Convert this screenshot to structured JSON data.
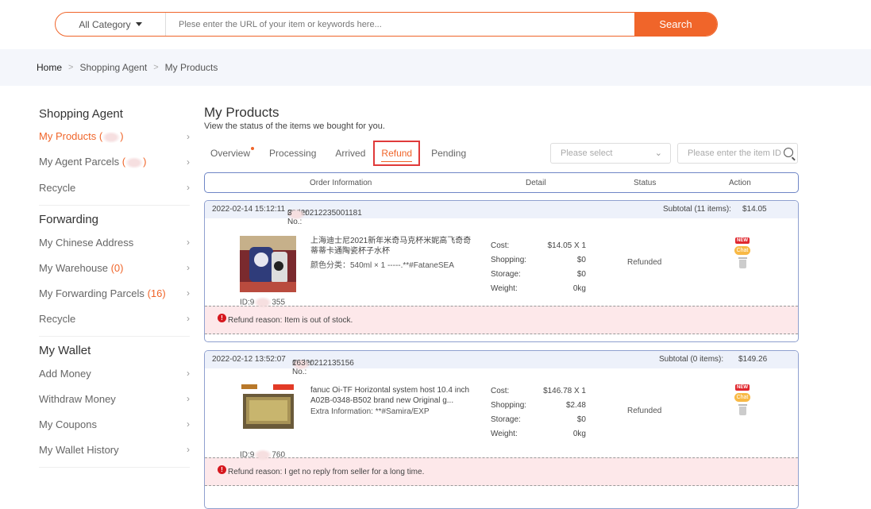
{
  "search": {
    "category": "All Category",
    "placeholder": "Plese enter the URL of your item or keywords here...",
    "button": "Search"
  },
  "breadcrumb": [
    "Home",
    "Shopping Agent",
    "My Products"
  ],
  "sidebar": {
    "groups": [
      {
        "title": "Shopping Agent",
        "items": [
          {
            "label": "My Products",
            "count": "",
            "active": true,
            "blurred": true
          },
          {
            "label": "My Agent Parcels",
            "count": "",
            "blurred": true
          },
          {
            "label": "Recycle",
            "count": ""
          }
        ]
      },
      {
        "title": "Forwarding",
        "items": [
          {
            "label": "My Chinese Address",
            "count": ""
          },
          {
            "label": "My Warehouse",
            "count": "0"
          },
          {
            "label": "My Forwarding Parcels",
            "count": "16"
          },
          {
            "label": "Recycle",
            "count": ""
          }
        ]
      },
      {
        "title": "My Wallet",
        "items": [
          {
            "label": "Add Money",
            "count": ""
          },
          {
            "label": "Withdraw Money",
            "count": ""
          },
          {
            "label": "My Coupons",
            "count": ""
          },
          {
            "label": "My Wallet History",
            "count": ""
          }
        ]
      }
    ]
  },
  "main": {
    "title": "My Products",
    "subtitle": "View the status of the items we bought for you.",
    "tabs": [
      "Overview",
      "Processing",
      "Arrived",
      "Refund",
      "Pending"
    ],
    "selected_tab": "Refund",
    "filter_select_placeholder": "Please select",
    "filter_search_placeholder": "Please enter the item ID",
    "table_headers": {
      "order_info": "Order Information",
      "detail": "Detail",
      "status": "Status",
      "action": "Action"
    },
    "orders": [
      {
        "datetime": "2022-02-14 15:12:11",
        "order_no_label": "Order No.:",
        "order_no_a": "20220212235001181",
        "order_no_b": "3",
        "subtotal_label": "Subtotal (11 items):",
        "subtotal_value": "$14.05",
        "product_name": "上海迪士尼2021新年米奇马克杯米妮高飞奇奇蒂蒂卡通陶瓷杯子水杯",
        "product_extra": "颜色分类：540ml × 1 -----.**#FataneSEA",
        "id_a": "ID:9",
        "id_b": "355",
        "cost_label": "Cost:",
        "cost": "$14.05 X 1",
        "shopping_label": "Shopping:",
        "shopping": "$0",
        "storage_label": "Storage:",
        "storage": "$0",
        "weight_label": "Weight:",
        "weight": "0kg",
        "status": "Refunded",
        "refund_reason": "Refund reason: Item is out of stock."
      },
      {
        "datetime": "2022-02-12 13:52:07",
        "order_no_label": "Order No.:",
        "order_no_a": "20220212135156",
        "order_no_b": "163",
        "subtotal_label": "Subtotal (0 items):",
        "subtotal_value": "$149.26",
        "product_name": "fanuc Oi-TF Horizontal system host 10.4 inch A02B-0348-B502 brand new Original g...",
        "product_extra": "Extra Information: **#Samira/EXP",
        "id_a": "ID:9",
        "id_b": "760",
        "cost_label": "Cost:",
        "cost": "$146.78 X 1",
        "shopping_label": "Shopping:",
        "shopping": "$2.48",
        "storage_label": "Storage:",
        "storage": "$0",
        "weight_label": "Weight:",
        "weight": "0kg",
        "status": "Refunded",
        "refund_reason": "Refund reason: I get no reply from seller for a long time."
      }
    ],
    "action_icons": {
      "new": "NEW",
      "chat": "Chat"
    }
  }
}
